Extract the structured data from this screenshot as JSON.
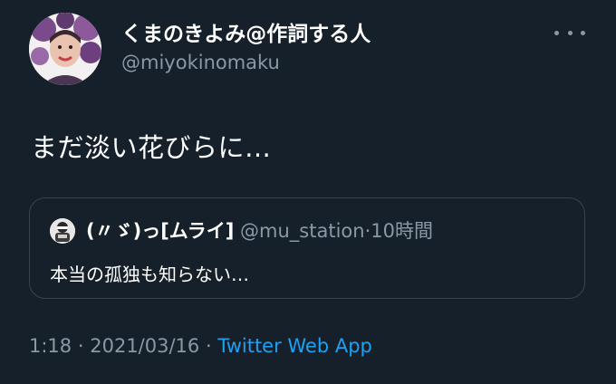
{
  "author": {
    "display_name": "くまのきよみ@作詞する人",
    "handle": "@miyokinomaku",
    "avatar_icon": "user-avatar-icon"
  },
  "tweet": {
    "text": "まだ淡い花びらに…"
  },
  "quoted_tweet": {
    "display_name": "(〃ゞ)っ[ムライ]",
    "handle": "@mu_station",
    "separator": "·",
    "time": "10時間",
    "text": "本当の孤独も知らない…"
  },
  "meta": {
    "time": "1:18",
    "sep1": "·",
    "date": "2021/03/16",
    "sep2": "·",
    "source": "Twitter Web App"
  },
  "colors": {
    "background": "#15202b",
    "secondary_text": "#8b98a5",
    "link": "#1da1f2",
    "border": "#38444d"
  },
  "icons": {
    "more": "more-horizontal-icon"
  }
}
